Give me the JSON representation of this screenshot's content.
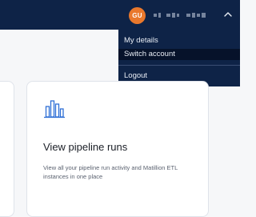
{
  "header": {
    "avatar_initials": "GU",
    "avatar_color": "#e9782c",
    "bar_color": "#0e2347",
    "user_name_redacted": true,
    "menu_toggle_icon": "chevron-up-icon"
  },
  "user_menu": {
    "items": [
      {
        "label": "My details"
      },
      {
        "label": "Switch account"
      },
      {
        "label": "Logout"
      }
    ],
    "highlighted_item": "Switch account"
  },
  "card": {
    "icon": "bar-chart-icon",
    "icon_color": "#2f6fd6",
    "title": "View pipeline runs",
    "description": "View all your pipeline run activity and Matillion ETL instances in one place"
  }
}
